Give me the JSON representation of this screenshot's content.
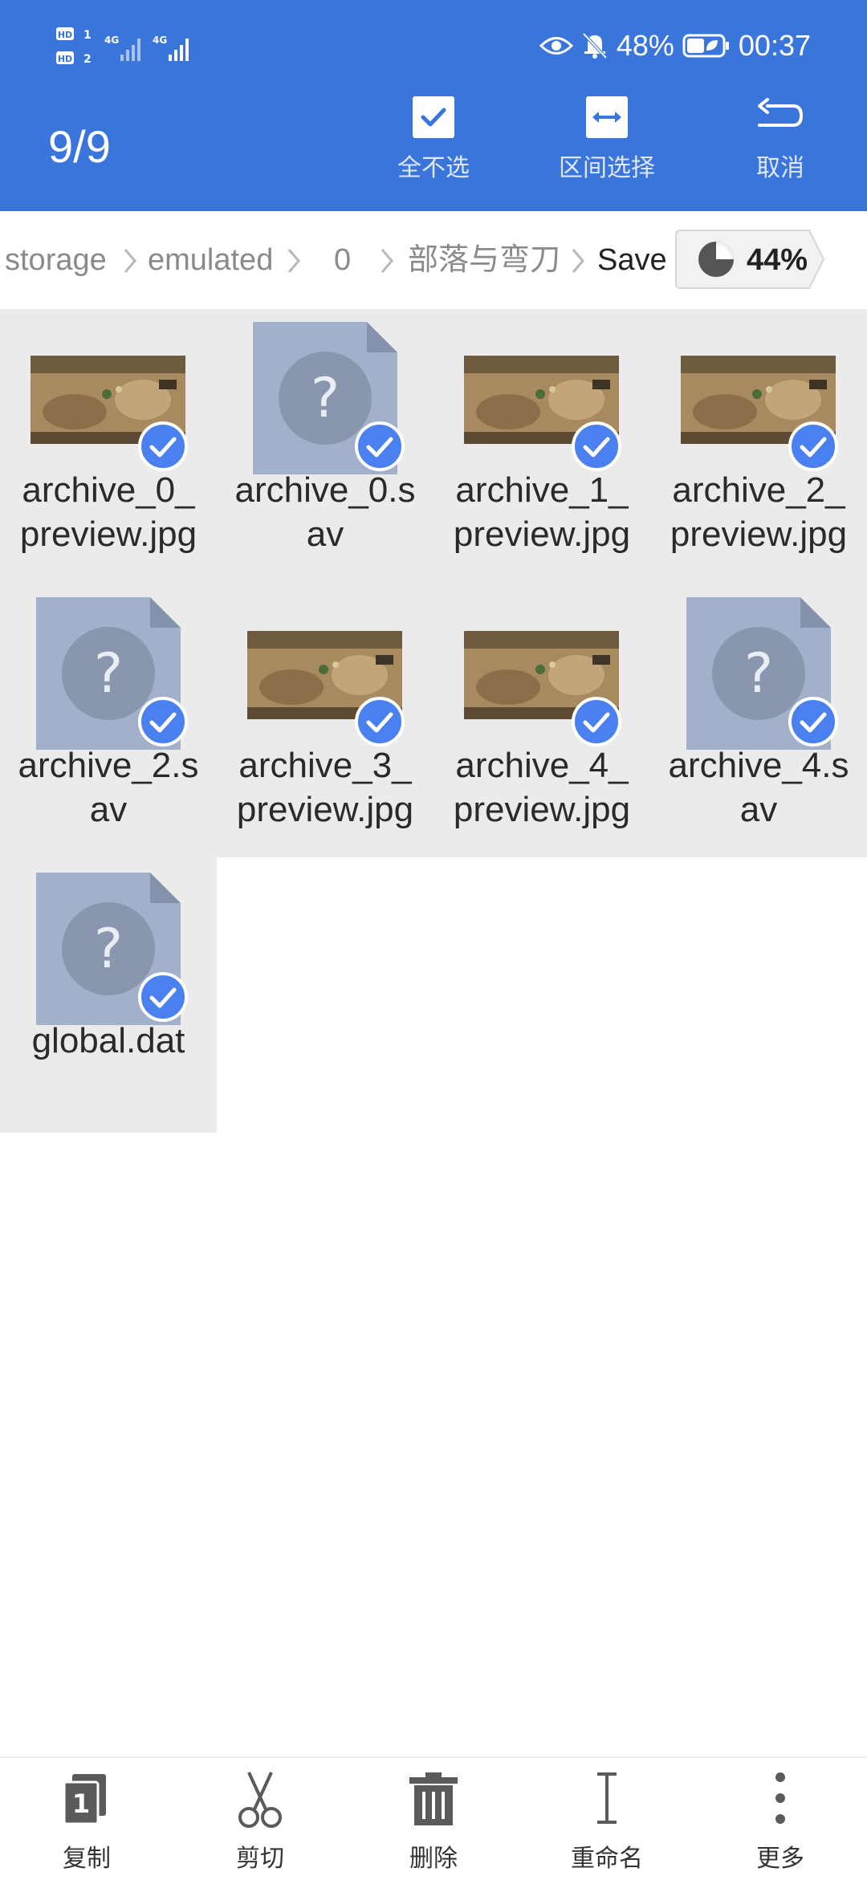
{
  "status_bar": {
    "sim1": "HD 1",
    "sim2": "HD 2",
    "net1": "4G",
    "net2": "4G",
    "battery": "48%",
    "time": "00:37"
  },
  "toolbar": {
    "selection_count": "9/9",
    "deselect_all_label": "全不选",
    "range_select_label": "区间选择",
    "cancel_label": "取消"
  },
  "breadcrumb": {
    "items": [
      "storage",
      "emulated",
      "0",
      "部落与弯刀",
      "Save"
    ],
    "storage_percent": "44%"
  },
  "files": [
    {
      "name": "archive_0_\npreview.jpg",
      "type": "image"
    },
    {
      "name": "archive_0.s\nav",
      "type": "unknown"
    },
    {
      "name": "archive_1_\npreview.jpg",
      "type": "image"
    },
    {
      "name": "archive_2_\npreview.jpg",
      "type": "image"
    },
    {
      "name": "archive_2.s\nav",
      "type": "unknown"
    },
    {
      "name": "archive_3_\npreview.jpg",
      "type": "image"
    },
    {
      "name": "archive_4_\npreview.jpg",
      "type": "image"
    },
    {
      "name": "archive_4.s\nav",
      "type": "unknown"
    },
    {
      "name": "global.dat",
      "type": "unknown"
    }
  ],
  "bottom_bar": {
    "copy_label": "复制",
    "cut_label": "剪切",
    "delete_label": "删除",
    "rename_label": "重命名",
    "more_label": "更多"
  },
  "colors": {
    "header": "#3a75dc",
    "check": "#4a80f0",
    "selected_bg": "#ebebeb"
  }
}
